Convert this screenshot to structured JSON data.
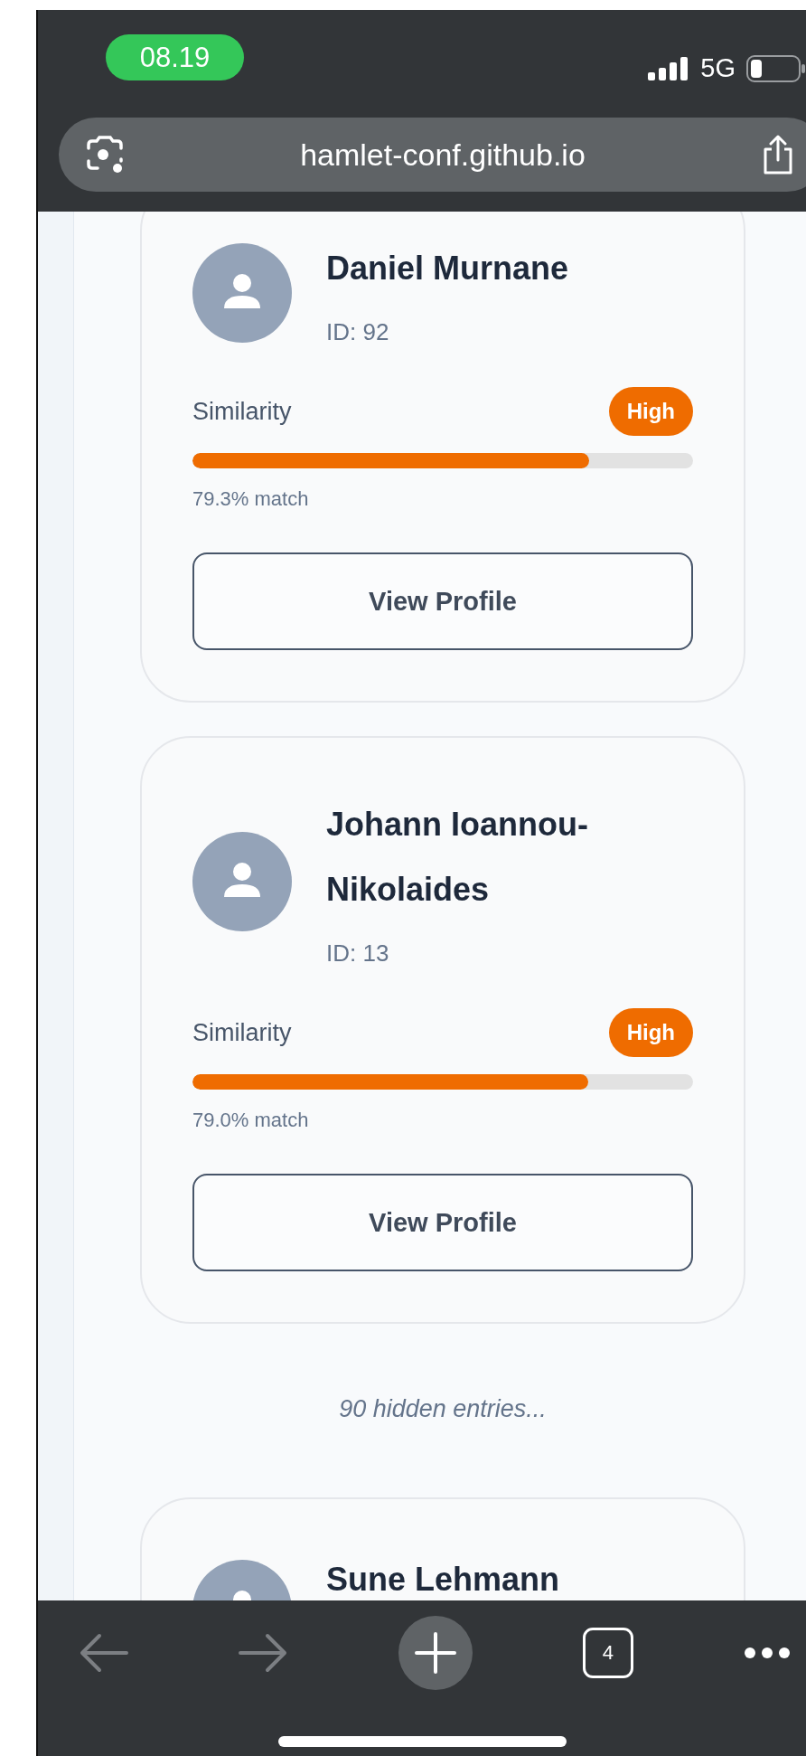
{
  "status_bar": {
    "time": "08.19",
    "network": "5G"
  },
  "address_bar": {
    "url": "hamlet-conf.github.io"
  },
  "results": [
    {
      "name": "Daniel Murnane",
      "id_label": "ID: 92",
      "similarity_label": "Similarity",
      "badge": "High",
      "level": 0.793,
      "match": "79.3% match",
      "button": "View Profile"
    },
    {
      "name": "Johann Ioannou-Nikolaides",
      "id_label": "ID: 13",
      "similarity_label": "Similarity",
      "badge": "High",
      "level": 0.79,
      "match": "79.0% match",
      "button": "View Profile"
    }
  ],
  "hidden_note": "90 hidden entries...",
  "partial_result": {
    "name": "Sune Lehmann"
  },
  "toolbar": {
    "tab_count": "4"
  }
}
